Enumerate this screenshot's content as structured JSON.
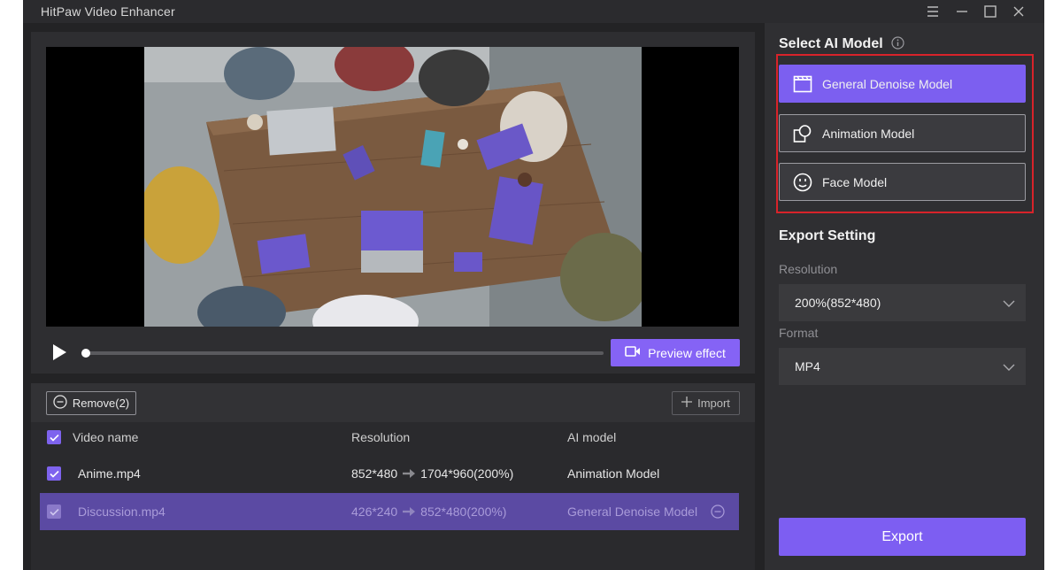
{
  "app": {
    "title": "HitPaw Video Enhancer"
  },
  "window_controls": [
    "menu-icon",
    "minimize-icon",
    "maximize-icon",
    "close-icon"
  ],
  "preview": {
    "preview_button_label": "Preview effect",
    "progress": 0
  },
  "list": {
    "remove_label": "Remove(2)",
    "import_label": "Import",
    "columns": {
      "name": "Video name",
      "resolution": "Resolution",
      "model": "AI model"
    },
    "rows": [
      {
        "name": "Anime.mp4",
        "res_from": "852*480",
        "res_to": "1704*960(200%)",
        "model": "Animation Model",
        "checked": true,
        "selected": false
      },
      {
        "name": "Discussion.mp4",
        "res_from": "426*240",
        "res_to": "852*480(200%)",
        "model": "General Denoise Model",
        "checked": true,
        "selected": true
      }
    ]
  },
  "sidebar": {
    "select_model_title": "Select AI Model",
    "models": [
      {
        "label": "General Denoise Model",
        "icon": "film-clapper-icon",
        "active": true
      },
      {
        "label": "Animation Model",
        "icon": "shapes-icon",
        "active": false
      },
      {
        "label": "Face Model",
        "icon": "face-icon",
        "active": false
      }
    ],
    "export_setting_title": "Export Setting",
    "resolution_label": "Resolution",
    "resolution_value": "200%(852*480)",
    "format_label": "Format",
    "format_value": "MP4",
    "export_label": "Export"
  },
  "colors": {
    "accent": "#7d5ef2",
    "highlight_frame": "#d8232a",
    "selected_row": "#5b4aa3",
    "panel": "#2f2f32"
  }
}
